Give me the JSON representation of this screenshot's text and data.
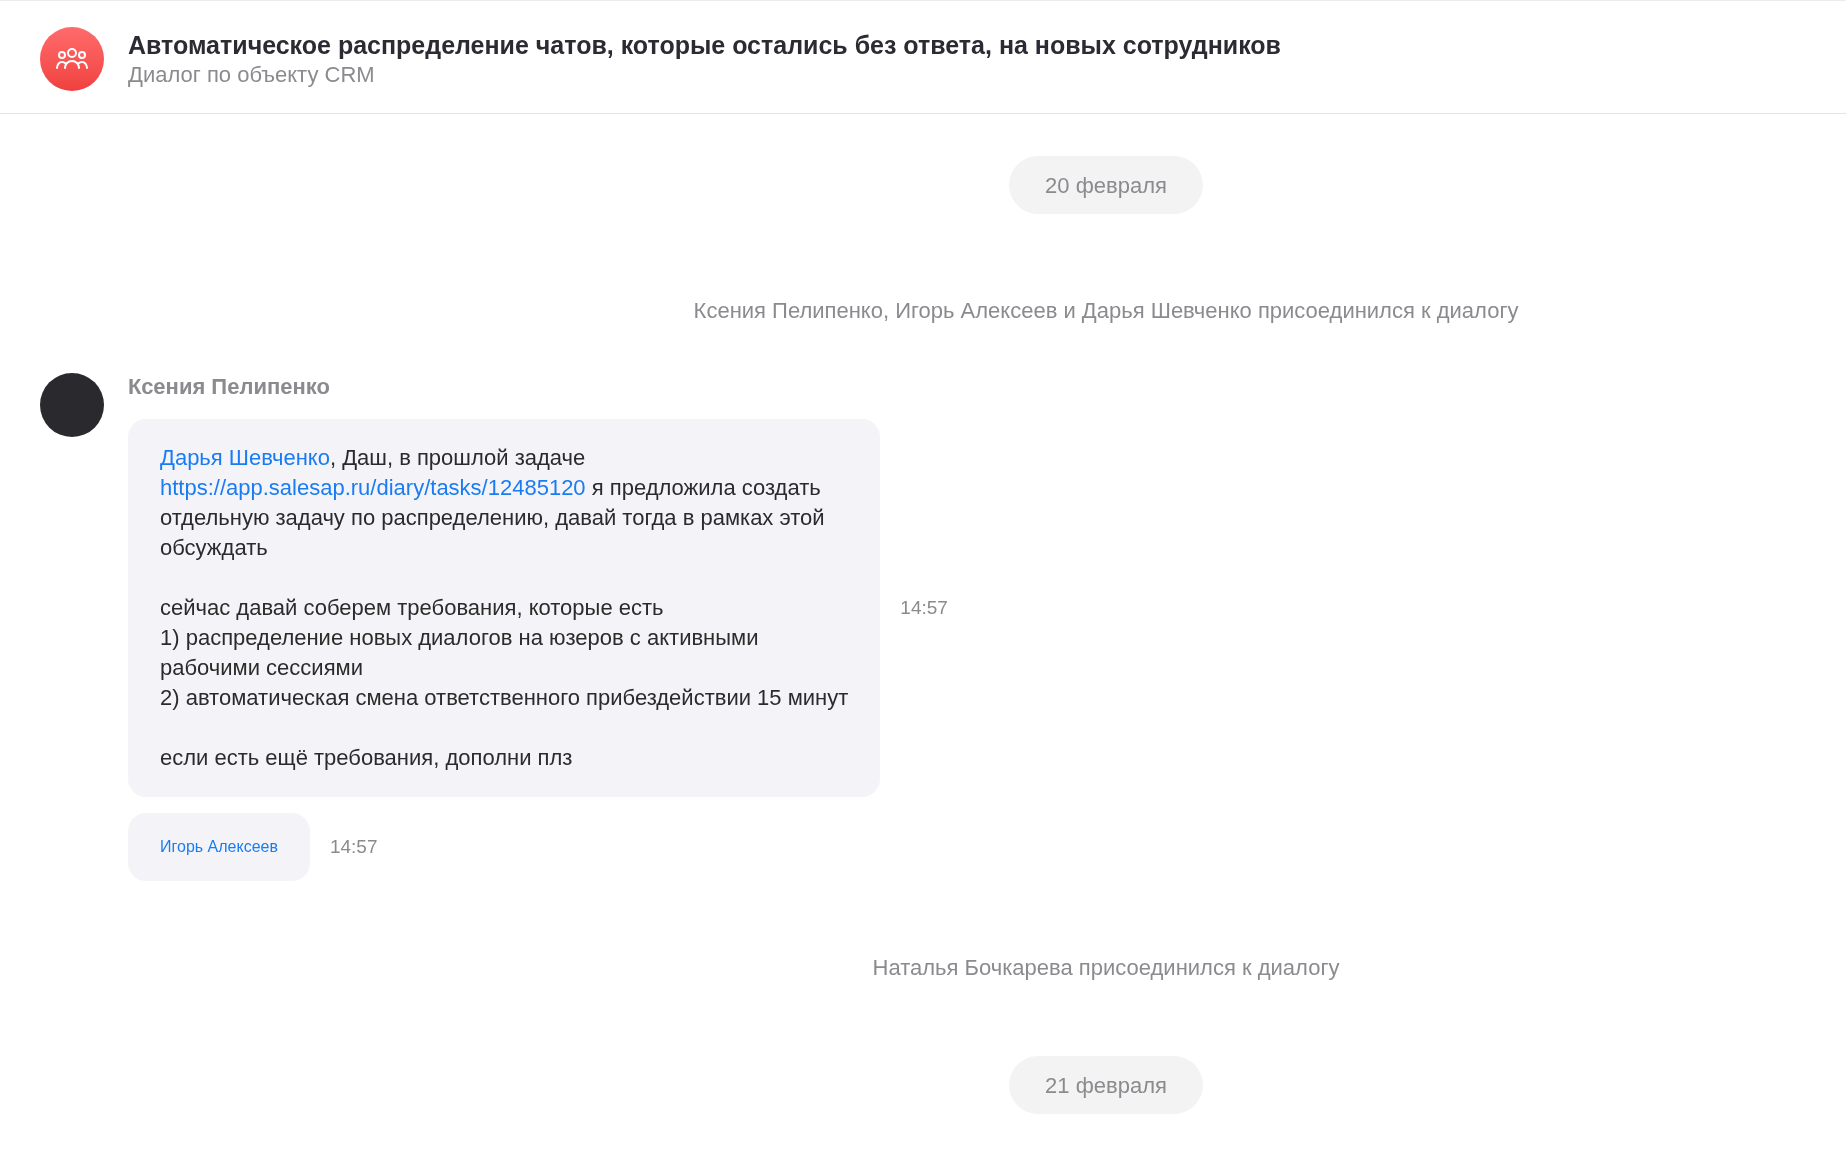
{
  "header": {
    "title": "Автоматическое распределение чатов, которые остались без ответа, на новых сотрудников",
    "subtitle": "Диалог по объекту CRM"
  },
  "feed": [
    {
      "kind": "date",
      "text": "20 февраля"
    },
    {
      "kind": "system",
      "text": "Ксения Пелипенко, Игорь Алексеев и Дарья Шевченко присоединился к диалогу"
    },
    {
      "kind": "group",
      "author": "Ксения Пелипенко",
      "messages": [
        {
          "time": "14:57",
          "parts": [
            {
              "kind": "mention",
              "text": "Дарья Шевченко"
            },
            {
              "kind": "text",
              "text": ", Даш, в прошлой задаче\n"
            },
            {
              "kind": "link",
              "text": "https://app.salesap.ru/diary/tasks/12485120"
            },
            {
              "kind": "text",
              "text": " я предложила создать\nотдельную задачу по распределению, давай тогда в рамках этой\nобсуждать\n\nсейчас давай соберем требования, которые есть\n1) распределение новых диалогов на юзеров с активными\nрабочими сессиями\n2) автоматическая смена ответственного прибездействии 15 минут\n\nесли есть ещё требования, дополни плз"
            }
          ]
        },
        {
          "time": "14:57",
          "parts": [
            {
              "kind": "mention",
              "text": "Игорь Алексеев"
            }
          ]
        }
      ]
    },
    {
      "kind": "system",
      "text": "Наталья Бочкарева присоединился к диалогу"
    },
    {
      "kind": "date",
      "text": "21 февраля"
    }
  ]
}
